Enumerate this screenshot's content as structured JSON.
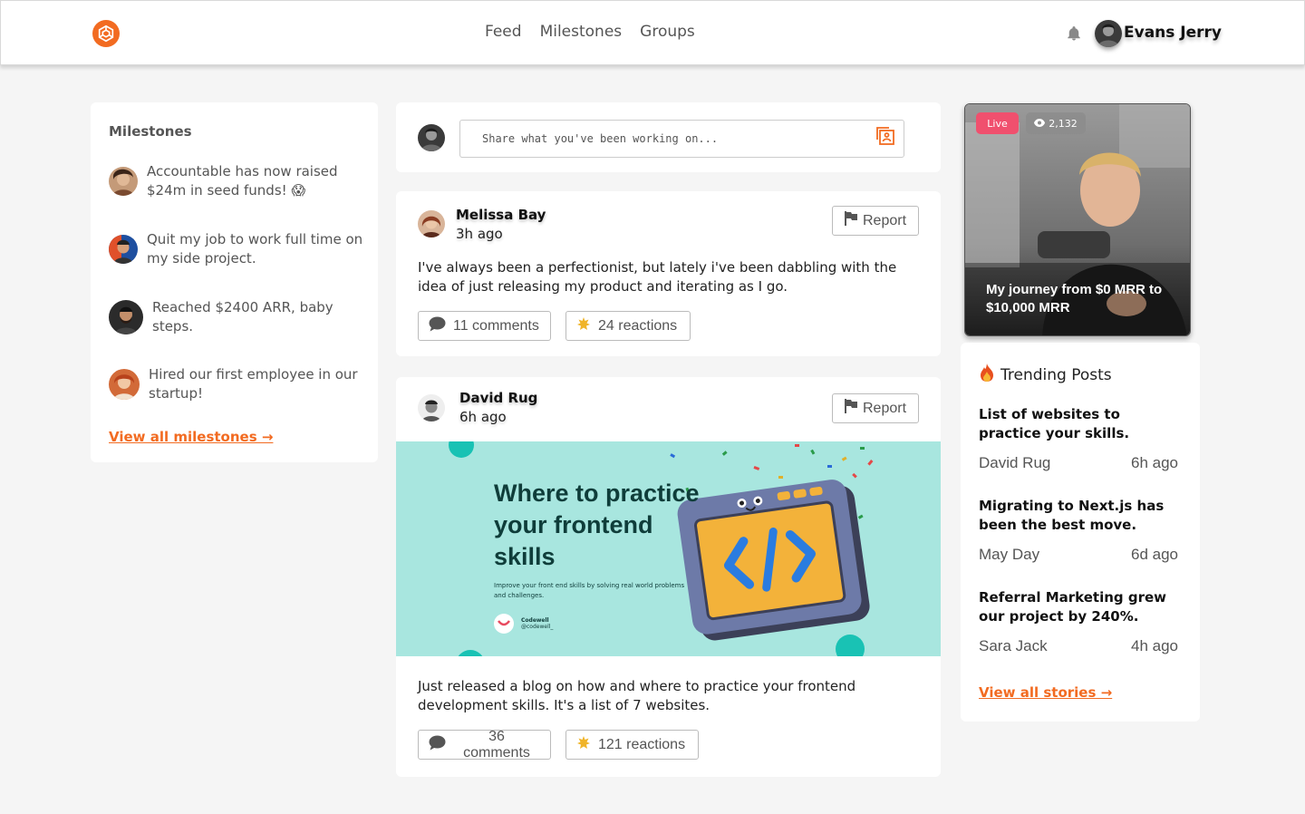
{
  "header": {
    "nav": [
      "Feed",
      "Milestones",
      "Groups"
    ],
    "user_name": "Evans Jerry"
  },
  "milestones": {
    "title": "Milestones",
    "items": [
      {
        "text": "Accountable has now raised $24m in seed funds! 😱"
      },
      {
        "text": "Quit my job to work full time on my side project."
      },
      {
        "text": "Reached $2400 ARR, baby steps."
      },
      {
        "text": "Hired our first employee in our startup!"
      }
    ],
    "view_all": "View all milestones →"
  },
  "composer": {
    "placeholder": "Share what you've been working on..."
  },
  "posts": [
    {
      "author": "Melissa Bay",
      "time": "3h ago",
      "report": "Report",
      "body": "I've always been a perfectionist, but lately i've been dabbling with the idea of just releasing my product and iterating as I go.",
      "comments": "11 comments",
      "reactions": "24 reactions"
    },
    {
      "author": "David Rug",
      "time": "6h ago",
      "report": "Report",
      "image": {
        "headline": "Where to practice your frontend skills",
        "subtext": "Improve your front end skills by solving real world problems and challenges.",
        "brand": "Codewell",
        "handle": "@codewell_"
      },
      "body": "Just released a blog on how and where to practice your frontend development skills. It's a list of 7 websites.",
      "comments": "36 comments",
      "reactions": "121 reactions"
    }
  ],
  "live": {
    "badge": "Live",
    "views": "2,132",
    "title": "My journey from $0 MRR to $10,000 MRR"
  },
  "trending": {
    "title": "Trending Posts",
    "items": [
      {
        "title": "List of websites to practice your skills.",
        "author": "David Rug",
        "time": "6h ago"
      },
      {
        "title": "Migrating to Next.js has been the best move.",
        "author": "May Day",
        "time": "6d ago"
      },
      {
        "title": "Referral Marketing grew our project by 240%.",
        "author": "Sara Jack",
        "time": "4h ago"
      }
    ],
    "view_all": "View all stories →"
  },
  "colors": {
    "accent": "#f26b21",
    "live": "#f0506e",
    "image_bg": "#a8e6df",
    "background": "#f5f5f5"
  }
}
